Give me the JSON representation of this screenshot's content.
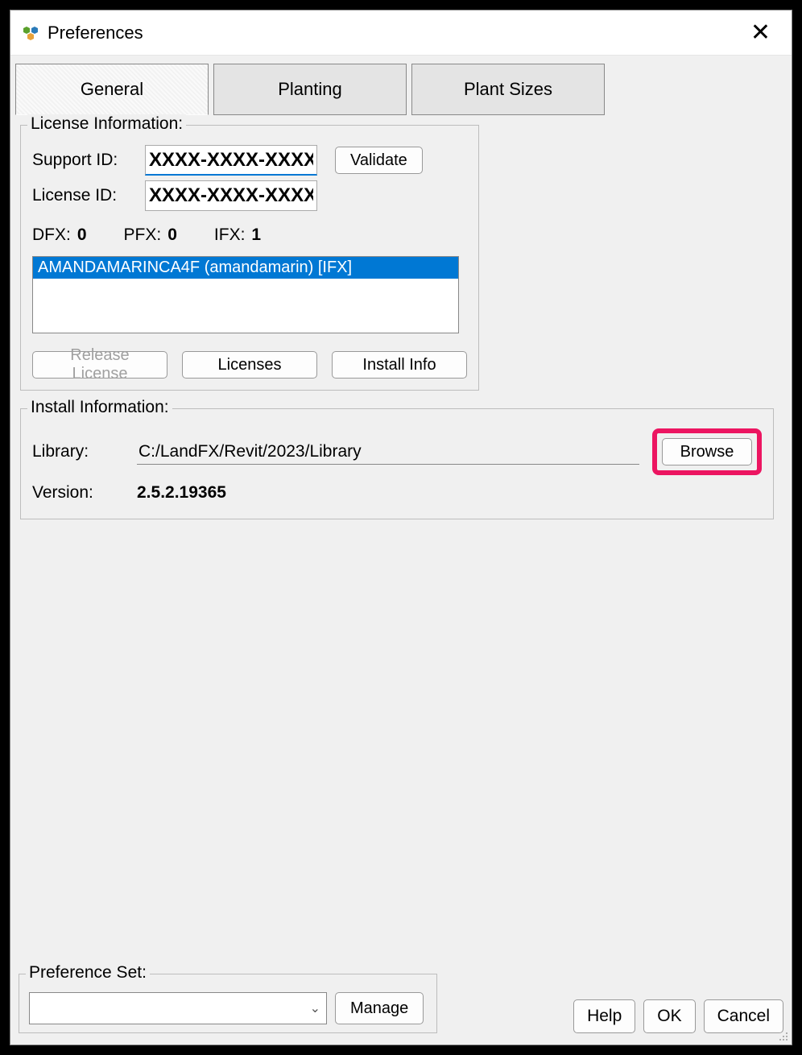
{
  "window": {
    "title": "Preferences"
  },
  "tabs": {
    "general": "General",
    "planting": "Planting",
    "plant_sizes": "Plant Sizes"
  },
  "license": {
    "legend": "License Information:",
    "support_id_label": "Support ID:",
    "support_id_value": "XXXX-XXXX-XXXX",
    "license_id_label": "License ID:",
    "license_id_value": "XXXX-XXXX-XXXX",
    "validate_label": "Validate",
    "dfx_label": "DFX:",
    "dfx_value": "0",
    "pfx_label": "PFX:",
    "pfx_value": "0",
    "ifx_label": "IFX:",
    "ifx_value": "1",
    "list_item": "AMANDAMARINCA4F (amandamarin) [IFX]",
    "release_label": "Release License",
    "licenses_label": "Licenses",
    "install_info_label": "Install Info"
  },
  "install": {
    "legend": "Install Information:",
    "library_label": "Library:",
    "library_path": "C:/LandFX/Revit/2023/Library",
    "browse_label": "Browse",
    "version_label": "Version:",
    "version_value": "2.5.2.19365"
  },
  "pref_set": {
    "legend": "Preference Set:",
    "combo_value": "",
    "manage_label": "Manage"
  },
  "actions": {
    "help": "Help",
    "ok": "OK",
    "cancel": "Cancel"
  },
  "colors": {
    "highlight": "#ec1561",
    "selection": "#0078d4"
  }
}
